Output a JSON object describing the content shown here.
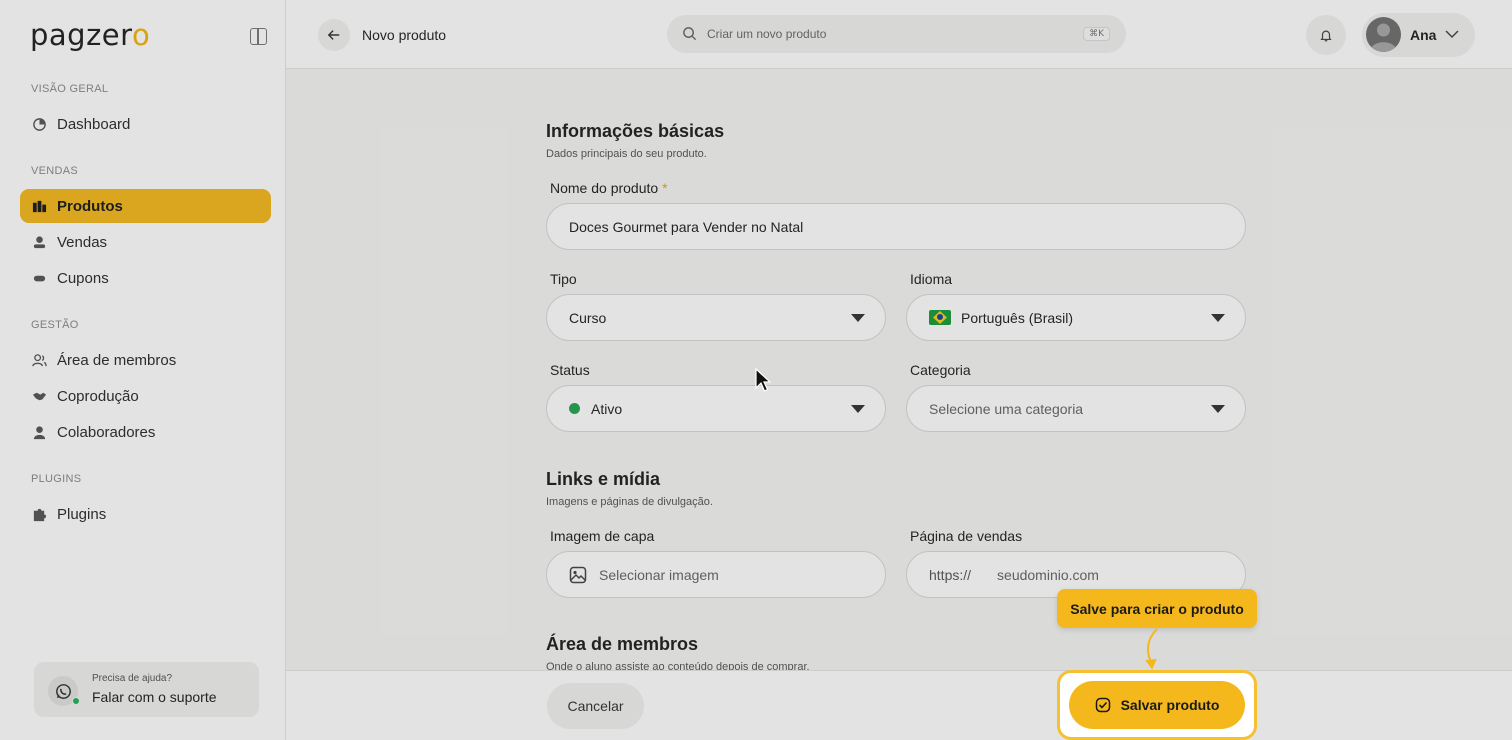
{
  "brand": {
    "logo_text_main": "pagzer",
    "logo_text_accent": "o",
    "accent_color": "#f5b81c"
  },
  "sidebar": {
    "sections": [
      {
        "label": "VISÃO GERAL",
        "items": [
          {
            "label": "Dashboard",
            "icon": "dashboard-icon"
          }
        ]
      },
      {
        "label": "VENDAS",
        "items": [
          {
            "label": "Produtos",
            "icon": "products-icon",
            "active": true
          },
          {
            "label": "Vendas",
            "icon": "sales-icon"
          },
          {
            "label": "Cupons",
            "icon": "coupon-icon"
          }
        ]
      },
      {
        "label": "GESTÃO",
        "items": [
          {
            "label": "Área de membros",
            "icon": "members-icon"
          },
          {
            "label": "Coprodução",
            "icon": "handshake-icon"
          },
          {
            "label": "Colaboradores",
            "icon": "user-icon"
          }
        ]
      },
      {
        "label": "PLUGINS",
        "items": [
          {
            "label": "Plugins",
            "icon": "puzzle-icon"
          }
        ]
      }
    ],
    "help": {
      "small": "Precisa de ajuda?",
      "big": "Falar com o suporte",
      "icon": "whatsapp-icon"
    }
  },
  "topbar": {
    "title": "Novo produto",
    "search_placeholder": "Criar um novo produto",
    "shortcut": "⌘K",
    "user_name": "Ana"
  },
  "form": {
    "basic": {
      "title": "Informações básicas",
      "subtitle": "Dados principais do seu produto.",
      "name_label": "Nome do produto",
      "name_required": "*",
      "name_value": "Doces Gourmet para Vender no Natal",
      "type_label": "Tipo",
      "type_value": "Curso",
      "language_label": "Idioma",
      "language_value": "Português (Brasil)",
      "status_label": "Status",
      "status_value": "Ativo",
      "status_color": "#22a552",
      "category_label": "Categoria",
      "category_placeholder": "Selecione uma categoria"
    },
    "links": {
      "title": "Links e mídia",
      "subtitle": "Imagens e páginas de divulgação.",
      "cover_label": "Imagem de capa",
      "cover_button": "Selecionar imagem",
      "sales_page_label": "Página de vendas",
      "sales_page_prefix": "https://",
      "sales_page_placeholder": "seudominio.com"
    },
    "members": {
      "title": "Área de membros",
      "subtitle": "Onde o aluno assiste ao conteúdo depois de comprar."
    }
  },
  "footer": {
    "cancel": "Cancelar",
    "save": "Salvar produto",
    "tooltip": "Salve para criar o produto"
  }
}
